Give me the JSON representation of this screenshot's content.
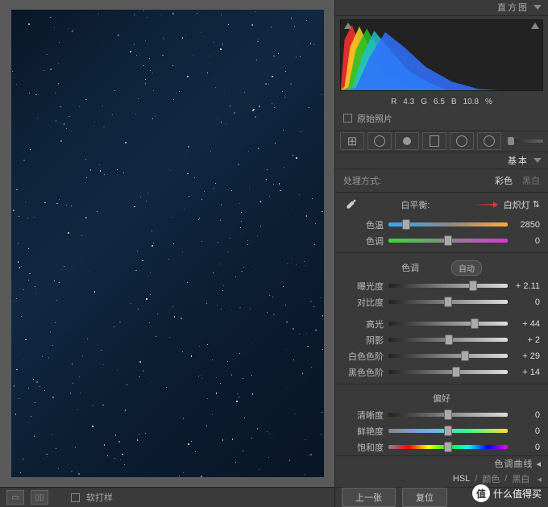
{
  "histogram_panel": {
    "title": "直方图",
    "rgb": {
      "r_label": "R",
      "r": "4.3",
      "g_label": "G",
      "g": "6.5",
      "b_label": "B",
      "b": "10.8",
      "pct": "%"
    },
    "original": "原始照片"
  },
  "basic": {
    "title": "基本",
    "treatment_label": "处理方式:",
    "color": "彩色",
    "bw": "黑白",
    "wb": {
      "label": "白平衡:",
      "preset": "白炽灯"
    },
    "temp": {
      "label": "色温",
      "value": "2850"
    },
    "tint": {
      "label": "色调",
      "value": "0"
    },
    "tone_header": "色调",
    "auto": "自动",
    "exposure": {
      "label": "曝光度",
      "value": "+ 2.11"
    },
    "contrast": {
      "label": "对比度",
      "value": "0"
    },
    "highlights": {
      "label": "高光",
      "value": "+ 44"
    },
    "shadows": {
      "label": "阴影",
      "value": "+ 2"
    },
    "whites": {
      "label": "白色色阶",
      "value": "+ 29"
    },
    "blacks": {
      "label": "黑色色阶",
      "value": "+ 14"
    },
    "presence_header": "偏好",
    "clarity": {
      "label": "清晰度",
      "value": "0"
    },
    "vibrance": {
      "label": "鲜艳度",
      "value": "0"
    },
    "saturation": {
      "label": "饱和度",
      "value": "0"
    }
  },
  "tone_curve": {
    "title": "色调曲线"
  },
  "hsl": {
    "hsl": "HSL",
    "color": "颜色",
    "bw": "黑白"
  },
  "nav": {
    "prev": "上一张",
    "reset": "复位"
  },
  "bottom": {
    "softproof": "软打样"
  },
  "watermark": {
    "text": "什么值得买",
    "badge": "值"
  },
  "chart_data": {
    "type": "area",
    "title": "Histogram",
    "channels": [
      {
        "name": "R",
        "color": "#ff3030",
        "curve": [
          [
            0,
            5
          ],
          [
            2,
            70
          ],
          [
            6,
            90
          ],
          [
            12,
            50
          ],
          [
            20,
            20
          ],
          [
            30,
            5
          ],
          [
            40,
            0
          ]
        ]
      },
      {
        "name": "Y",
        "color": "#ffd020",
        "curve": [
          [
            2,
            5
          ],
          [
            5,
            60
          ],
          [
            10,
            88
          ],
          [
            16,
            55
          ],
          [
            24,
            22
          ],
          [
            34,
            6
          ],
          [
            44,
            0
          ]
        ]
      },
      {
        "name": "G",
        "color": "#20c020",
        "curve": [
          [
            4,
            4
          ],
          [
            8,
            55
          ],
          [
            14,
            85
          ],
          [
            20,
            58
          ],
          [
            28,
            25
          ],
          [
            38,
            8
          ],
          [
            48,
            0
          ]
        ]
      },
      {
        "name": "C",
        "color": "#20c0d0",
        "curve": [
          [
            6,
            3
          ],
          [
            12,
            50
          ],
          [
            18,
            82
          ],
          [
            26,
            58
          ],
          [
            36,
            28
          ],
          [
            48,
            10
          ],
          [
            58,
            0
          ]
        ]
      },
      {
        "name": "B",
        "color": "#3070ff",
        "curve": [
          [
            8,
            3
          ],
          [
            16,
            48
          ],
          [
            24,
            80
          ],
          [
            34,
            60
          ],
          [
            46,
            32
          ],
          [
            60,
            12
          ],
          [
            74,
            2
          ],
          [
            86,
            0
          ]
        ]
      }
    ],
    "xrange": [
      0,
      255
    ],
    "yrange": [
      0,
      100
    ]
  }
}
